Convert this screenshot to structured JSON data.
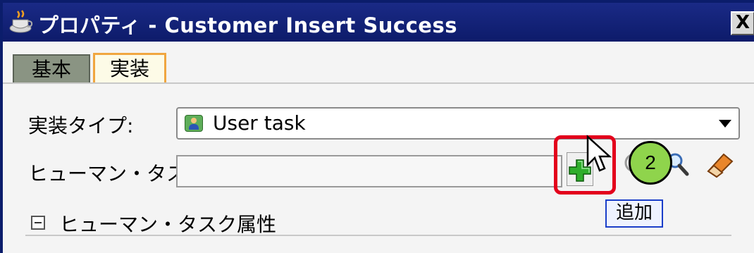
{
  "window": {
    "title": "プロパティ - Customer Insert Success",
    "close_label": "X"
  },
  "tabs": [
    {
      "label": "基本"
    },
    {
      "label": "実装"
    }
  ],
  "form": {
    "impl_type_label": "実装タイプ:",
    "impl_type_value": "User task",
    "human_task_label": "ヒューマン・タスク:",
    "human_task_value": "",
    "section_label": "ヒューマン・タスク属性"
  },
  "callout": {
    "badge": "2",
    "tooltip": "追加"
  },
  "icons": {
    "app": "coffee-cup-icon",
    "add": "green-plus-icon",
    "search": "magnifier-icon",
    "clear": "eraser-icon",
    "type": "user-icon"
  },
  "colors": {
    "title_bar": "#0d1b6a",
    "highlight": "#e3001b",
    "badge": "#8fd44c",
    "active_tab_border": "#f0a640"
  }
}
